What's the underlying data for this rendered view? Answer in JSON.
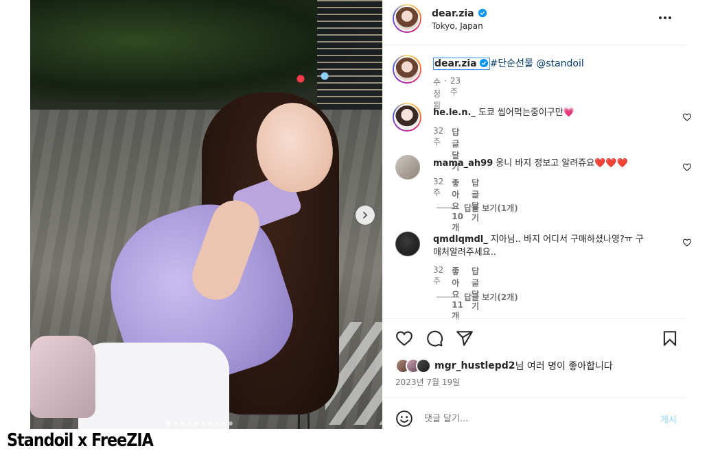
{
  "caption_overlay": "Standoil x FreeZIA",
  "post": {
    "author": "dear.zia",
    "location": "Tokyo, Japan",
    "caption": {
      "username": "dear.zia",
      "hashtag": "#단순선물",
      "mention": "@standoil",
      "edited": "수정됨",
      "separator": "·",
      "time": "23주"
    }
  },
  "comments": [
    {
      "username": "he.le.n._",
      "text": "도쿄 씹어먹는중이구만💗",
      "time": "32주",
      "likes": "",
      "reply": "답글 달기",
      "view_replies": ""
    },
    {
      "username": "mama_ah99",
      "text": "웅니 바지 정보고 알려쥬요❤️❤️❤️",
      "time": "32주",
      "likes": "좋아요 10개",
      "reply": "답글 달기",
      "view_replies": "답글 보기(1개)"
    },
    {
      "username": "qmdlqmdl_",
      "text": "지아님.. 바지 어디서 구매하셨나영?ㅠ 구매처알려주세요..",
      "time": "32주",
      "likes": "좋아요 11개",
      "reply": "답글 달기",
      "view_replies": "답글 보기(2개)"
    }
  ],
  "likes": {
    "liker": "mgr_hustlepd2",
    "suffix": "님 여러 명이 좋아합니다"
  },
  "date": "2023년 7월 19일",
  "composer": {
    "placeholder": "댓글 달기...",
    "post_label": "게시"
  },
  "icons": {
    "verified": "verified-badge-icon",
    "more": "more-options-icon",
    "like": "heart-icon",
    "comment": "comment-bubble-icon",
    "share": "paper-plane-icon",
    "save": "bookmark-icon",
    "emoji": "smiley-icon",
    "next": "chevron-right-icon"
  },
  "carousel": {
    "count": 10,
    "active_index": 0
  },
  "colors": {
    "link": "#00376b",
    "secondary_text": "#737373",
    "verified_blue": "#0095f6",
    "post_disabled": "#b2dffc",
    "heart_emoji": "#e0245e"
  }
}
